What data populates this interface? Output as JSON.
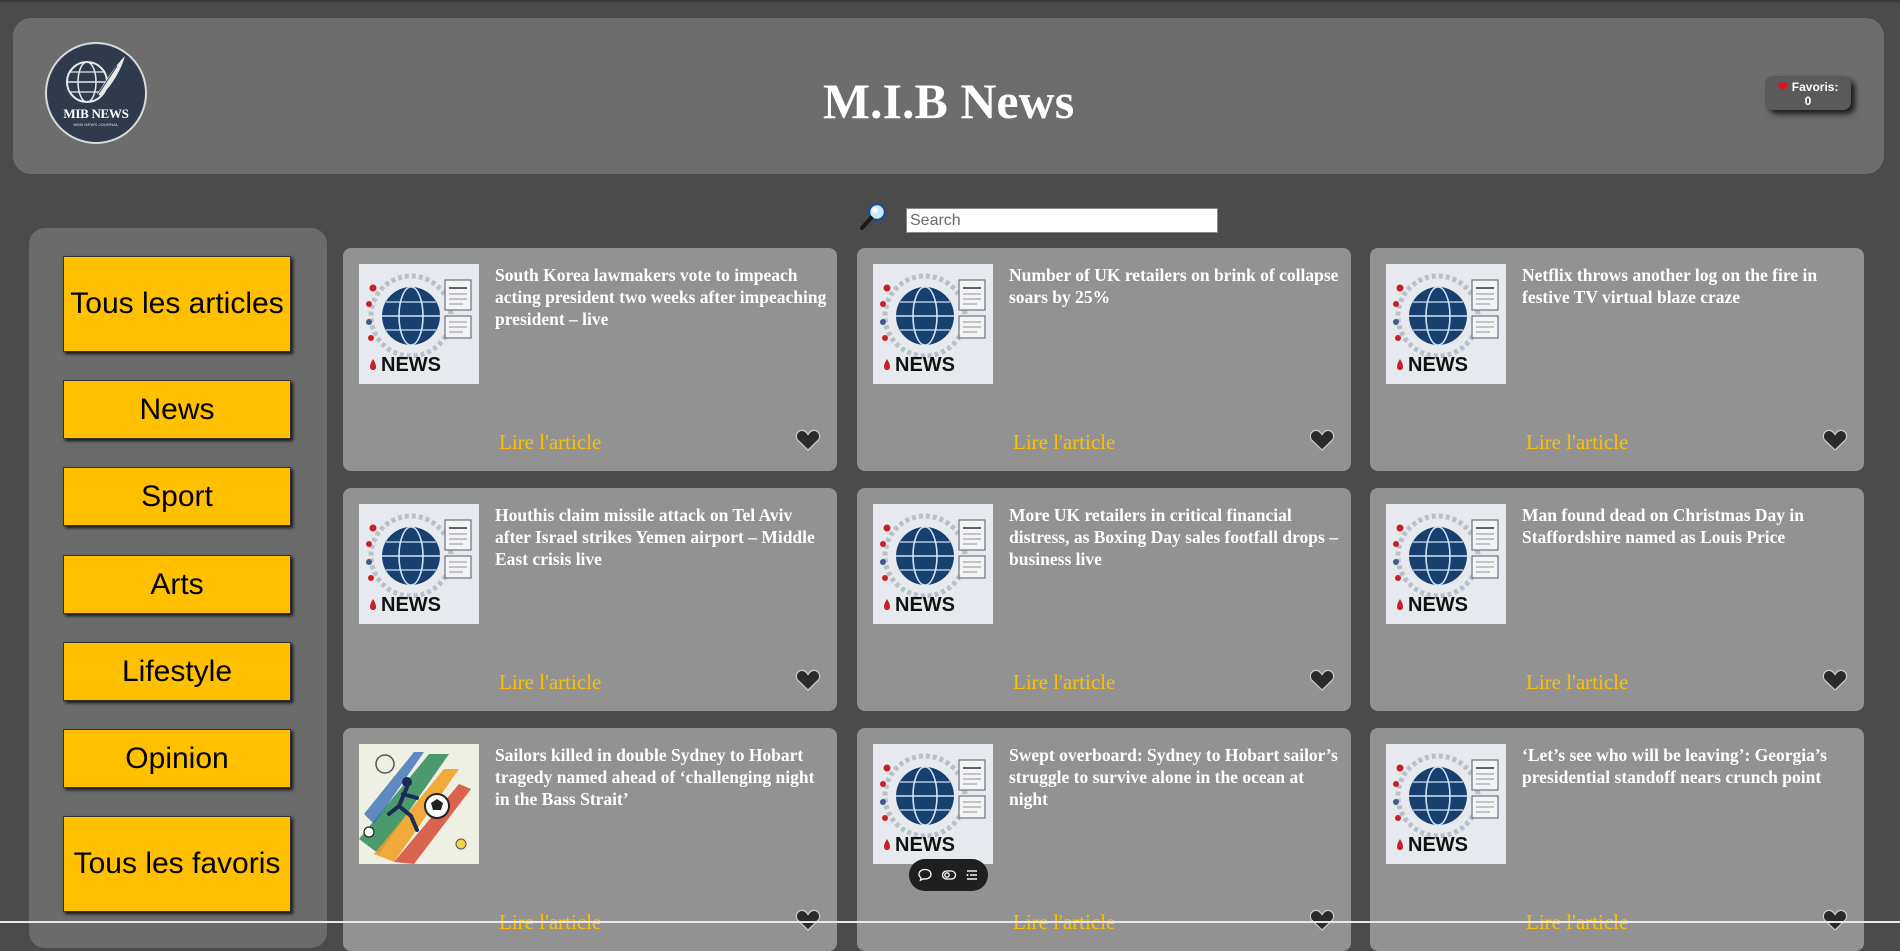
{
  "header": {
    "logo_text": "MIB NEWS",
    "logo_subtext": "WEB NEWS JOURNAL",
    "title": "M.I.B News",
    "favorites_label": "Favoris:",
    "favorites_count": "0"
  },
  "search": {
    "placeholder": "Search",
    "value": ""
  },
  "sidebar": {
    "items": [
      {
        "label": "Tous les articles"
      },
      {
        "label": "News"
      },
      {
        "label": "Sport"
      },
      {
        "label": "Arts"
      },
      {
        "label": "Lifestyle"
      },
      {
        "label": "Opinion"
      },
      {
        "label": "Tous les favoris"
      }
    ]
  },
  "articles": [
    {
      "title": "South Korea lawmakers vote to impeach acting president two weeks after impeaching president – live",
      "link": "Lire l'article",
      "thumbnail": "news-globe"
    },
    {
      "title": "Number of UK retailers on brink of collapse soars by 25%",
      "link": "Lire l'article",
      "thumbnail": "news-globe"
    },
    {
      "title": "Netflix throws another log on the fire in festive TV virtual blaze craze",
      "link": "Lire l'article",
      "thumbnail": "news-globe"
    },
    {
      "title": "Houthis claim missile attack on Tel Aviv after Israel strikes Yemen airport – Middle East crisis live",
      "link": "Lire l'article",
      "thumbnail": "news-globe"
    },
    {
      "title": "More UK retailers in critical financial distress, as Boxing Day sales footfall drops – business live",
      "link": "Lire l'article",
      "thumbnail": "news-globe"
    },
    {
      "title": "Man found dead on Christmas Day in Staffordshire named as Louis Price",
      "link": "Lire l'article",
      "thumbnail": "news-globe"
    },
    {
      "title": "Sailors killed in double Sydney to Hobart tragedy named ahead of ‘challenging night in the Bass Strait’",
      "link": "Lire l'article",
      "thumbnail": "sport-art"
    },
    {
      "title": "Swept overboard: Sydney to Hobart sailor’s struggle to survive alone in the ocean at night",
      "link": "Lire l'article",
      "thumbnail": "news-globe"
    },
    {
      "title": "‘Let’s see who will be leaving’: Georgia’s presidential standoff nears crunch point",
      "link": "Lire l'article",
      "thumbnail": "news-globe"
    }
  ],
  "thumbnail_text": "NEWS",
  "colors": {
    "page_bg": "#4b4b4b",
    "header_bg": "#6d6d6d",
    "sidebar_bg": "#6b6b6b",
    "card_bg": "#929292",
    "accent_yellow": "#ffc000",
    "heart_red": "#e0101c"
  },
  "icons": {
    "search": "magnifier-icon",
    "favorite": "heart-icon",
    "floating_toolbar": [
      "comment-icon",
      "toggle-icon",
      "list-icon"
    ]
  }
}
